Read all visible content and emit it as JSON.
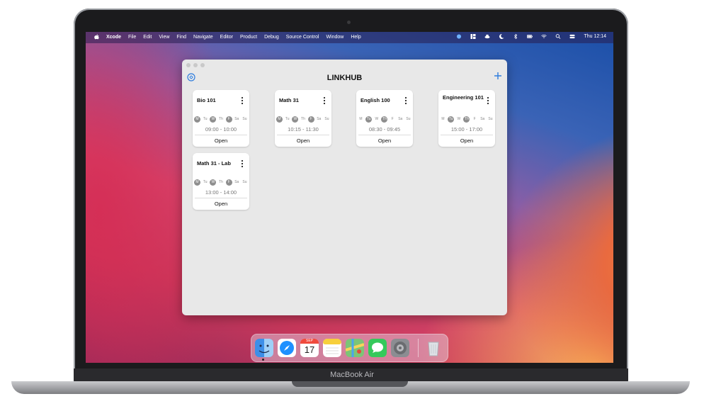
{
  "menubar": {
    "app_name": "Xcode",
    "menus": [
      "File",
      "Edit",
      "View",
      "Find",
      "Navigate",
      "Editor",
      "Product",
      "Debug",
      "Source Control",
      "Window",
      "Help"
    ],
    "clock": "Thu 12:14"
  },
  "window": {
    "title": "LINKHUB",
    "add_icon": "plus-icon",
    "settings_icon": "gear-icon"
  },
  "cards": [
    {
      "name": "Bio 101",
      "time": "09:00 - 10:00",
      "open": "Open",
      "days": [
        {
          "d": "M",
          "on": true
        },
        {
          "d": "Tu",
          "on": false
        },
        {
          "d": "W",
          "on": true
        },
        {
          "d": "Th",
          "on": false
        },
        {
          "d": "F",
          "on": true
        },
        {
          "d": "Sa",
          "on": false
        },
        {
          "d": "Su",
          "on": false
        }
      ]
    },
    {
      "name": "Math 31",
      "time": "10:15 - 11:30",
      "open": "Open",
      "days": [
        {
          "d": "M",
          "on": true
        },
        {
          "d": "Tu",
          "on": false
        },
        {
          "d": "W",
          "on": true
        },
        {
          "d": "Th",
          "on": false
        },
        {
          "d": "F",
          "on": true
        },
        {
          "d": "Sa",
          "on": false
        },
        {
          "d": "Su",
          "on": false
        }
      ]
    },
    {
      "name": "English 100",
      "time": "08:30 - 09:45",
      "open": "Open",
      "days": [
        {
          "d": "M",
          "on": false
        },
        {
          "d": "Tu",
          "on": true
        },
        {
          "d": "W",
          "on": false
        },
        {
          "d": "Th",
          "on": true
        },
        {
          "d": "F",
          "on": false
        },
        {
          "d": "Sa",
          "on": false
        },
        {
          "d": "Su",
          "on": false
        }
      ]
    },
    {
      "name": "Engineering 101",
      "time": "15:00 - 17:00",
      "open": "Open",
      "days": [
        {
          "d": "M",
          "on": false
        },
        {
          "d": "Tu",
          "on": true
        },
        {
          "d": "W",
          "on": false
        },
        {
          "d": "Th",
          "on": true
        },
        {
          "d": "F",
          "on": false
        },
        {
          "d": "Sa",
          "on": false
        },
        {
          "d": "Su",
          "on": false
        }
      ]
    },
    {
      "name": "Math 31 - Lab",
      "time": "13:00 - 14:00",
      "open": "Open",
      "days": [
        {
          "d": "M",
          "on": true
        },
        {
          "d": "Tu",
          "on": false
        },
        {
          "d": "W",
          "on": true
        },
        {
          "d": "Th",
          "on": false
        },
        {
          "d": "F",
          "on": true
        },
        {
          "d": "Sa",
          "on": false
        },
        {
          "d": "Su",
          "on": false
        }
      ]
    }
  ],
  "dock": {
    "apps": [
      "finder-icon",
      "safari-icon",
      "calendar-icon",
      "notes-icon",
      "maps-icon",
      "messages-icon",
      "system-preferences-icon",
      "trash-icon"
    ],
    "calendar_month": "SEP",
    "calendar_day": "17"
  },
  "device_label": "MacBook Air"
}
